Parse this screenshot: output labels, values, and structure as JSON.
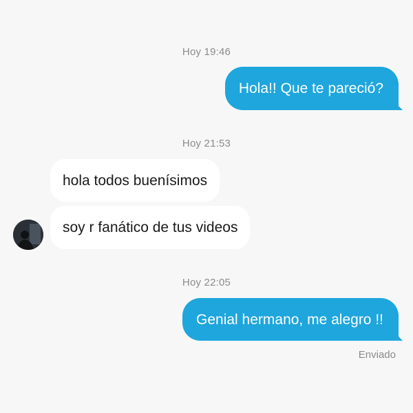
{
  "conversation": {
    "groups": [
      {
        "timestamp": "Hoy 19:46"
      },
      {
        "timestamp": "Hoy 21:53"
      },
      {
        "timestamp": "Hoy 22:05"
      }
    ],
    "messages": [
      {
        "text": "Hola!! Que te pareció?",
        "direction": "outgoing"
      },
      {
        "text": "hola todos buenísimos",
        "direction": "incoming"
      },
      {
        "text": "soy r fanático de tus videos",
        "direction": "incoming"
      },
      {
        "text": "Genial hermano, me alegro !!",
        "direction": "outgoing"
      }
    ],
    "status": "Enviado"
  },
  "colors": {
    "outgoing_bubble": "#1ea6dd",
    "incoming_bubble": "#ffffff",
    "background": "#f7f7f8",
    "timestamp_text": "#8a8a8a"
  },
  "icons": {
    "avatar": "user-avatar"
  }
}
